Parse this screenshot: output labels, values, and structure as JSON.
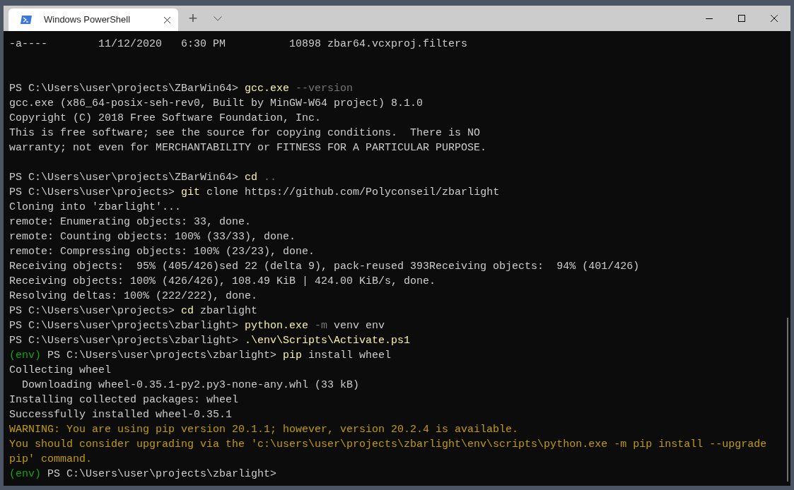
{
  "tab": {
    "title": "Windows PowerShell",
    "selected": true
  },
  "new_tab_button": "+",
  "terminal": {
    "lines": [
      {
        "segments": [
          {
            "kind": "output",
            "text": "-a----        11/12/2020   6:30 PM          10898 zbar64.vcxproj.filters"
          }
        ]
      },
      {
        "kind": "blank"
      },
      {
        "kind": "blank"
      },
      {
        "segments": [
          {
            "kind": "prompt",
            "text": "PS C:\\Users\\user\\projects\\ZBarWin64> "
          },
          {
            "kind": "command",
            "text": "gcc.exe"
          },
          {
            "kind": "parameter",
            "text": " --version"
          }
        ]
      },
      {
        "segments": [
          {
            "kind": "output",
            "text": "gcc.exe (x86_64-posix-seh-rev0, Built by MinGW-W64 project) 8.1.0"
          }
        ]
      },
      {
        "segments": [
          {
            "kind": "output",
            "text": "Copyright (C) 2018 Free Software Foundation, Inc."
          }
        ]
      },
      {
        "segments": [
          {
            "kind": "output",
            "text": "This is free software; see the source for copying conditions.  There is NO"
          }
        ]
      },
      {
        "segments": [
          {
            "kind": "output",
            "text": "warranty; not even for MERCHANTABILITY or FITNESS FOR A PARTICULAR PURPOSE."
          }
        ]
      },
      {
        "kind": "blank"
      },
      {
        "segments": [
          {
            "kind": "prompt",
            "text": "PS C:\\Users\\user\\projects\\ZBarWin64> "
          },
          {
            "kind": "command",
            "text": "cd"
          },
          {
            "kind": "parameter",
            "text": " .."
          }
        ]
      },
      {
        "segments": [
          {
            "kind": "prompt",
            "text": "PS C:\\Users\\user\\projects> "
          },
          {
            "kind": "command",
            "text": "git"
          },
          {
            "kind": "argument",
            "text": " clone https://github.com/Polyconseil/zbarlight"
          }
        ]
      },
      {
        "segments": [
          {
            "kind": "output",
            "text": "Cloning into 'zbarlight'..."
          }
        ]
      },
      {
        "segments": [
          {
            "kind": "output",
            "text": "remote: Enumerating objects: 33, done."
          }
        ]
      },
      {
        "segments": [
          {
            "kind": "output",
            "text": "remote: Counting objects: 100% (33/33), done."
          }
        ]
      },
      {
        "segments": [
          {
            "kind": "output",
            "text": "remote: Compressing objects: 100% (23/23), done."
          }
        ]
      },
      {
        "segments": [
          {
            "kind": "output",
            "text": "Receiving objects:  95% (405/426)sed 22 (delta 9), pack-reused 393Receiving objects:  94% (401/426)"
          }
        ]
      },
      {
        "segments": [
          {
            "kind": "output",
            "text": "Receiving objects: 100% (426/426), 108.49 KiB | 424.00 KiB/s, done."
          }
        ]
      },
      {
        "segments": [
          {
            "kind": "output",
            "text": "Resolving deltas: 100% (222/222), done."
          }
        ]
      },
      {
        "segments": [
          {
            "kind": "prompt",
            "text": "PS C:\\Users\\user\\projects> "
          },
          {
            "kind": "command",
            "text": "cd"
          },
          {
            "kind": "argument",
            "text": " zbarlight"
          }
        ]
      },
      {
        "segments": [
          {
            "kind": "prompt",
            "text": "PS C:\\Users\\user\\projects\\zbarlight> "
          },
          {
            "kind": "command",
            "text": "python.exe"
          },
          {
            "kind": "parameter",
            "text": " -m"
          },
          {
            "kind": "argument",
            "text": " venv env"
          }
        ]
      },
      {
        "segments": [
          {
            "kind": "prompt",
            "text": "PS C:\\Users\\user\\projects\\zbarlight> "
          },
          {
            "kind": "command",
            "text": ".\\env\\Scripts\\Activate.ps1"
          }
        ]
      },
      {
        "segments": [
          {
            "kind": "env",
            "text": "(env)"
          },
          {
            "kind": "prompt",
            "text": " PS C:\\Users\\user\\projects\\zbarlight> "
          },
          {
            "kind": "command",
            "text": "pip"
          },
          {
            "kind": "argument",
            "text": " install wheel"
          }
        ]
      },
      {
        "segments": [
          {
            "kind": "output",
            "text": "Collecting wheel"
          }
        ]
      },
      {
        "segments": [
          {
            "kind": "output",
            "text": "  Downloading wheel-0.35.1-py2.py3-none-any.whl (33 kB)"
          }
        ]
      },
      {
        "segments": [
          {
            "kind": "output",
            "text": "Installing collected packages: wheel"
          }
        ]
      },
      {
        "segments": [
          {
            "kind": "output",
            "text": "Successfully installed wheel-0.35.1"
          }
        ]
      },
      {
        "segments": [
          {
            "kind": "warning",
            "text": "WARNING: You are using pip version 20.1.1; however, version 20.2.4 is available."
          }
        ]
      },
      {
        "segments": [
          {
            "kind": "warning",
            "text": "You should consider upgrading via the 'c:\\users\\user\\projects\\zbarlight\\env\\scripts\\python.exe -m pip install --upgrade"
          }
        ]
      },
      {
        "segments": [
          {
            "kind": "warning",
            "text": "pip' command."
          }
        ]
      },
      {
        "segments": [
          {
            "kind": "env",
            "text": "(env)"
          },
          {
            "kind": "prompt",
            "text": " PS C:\\Users\\user\\projects\\zbarlight> "
          }
        ]
      }
    ]
  }
}
